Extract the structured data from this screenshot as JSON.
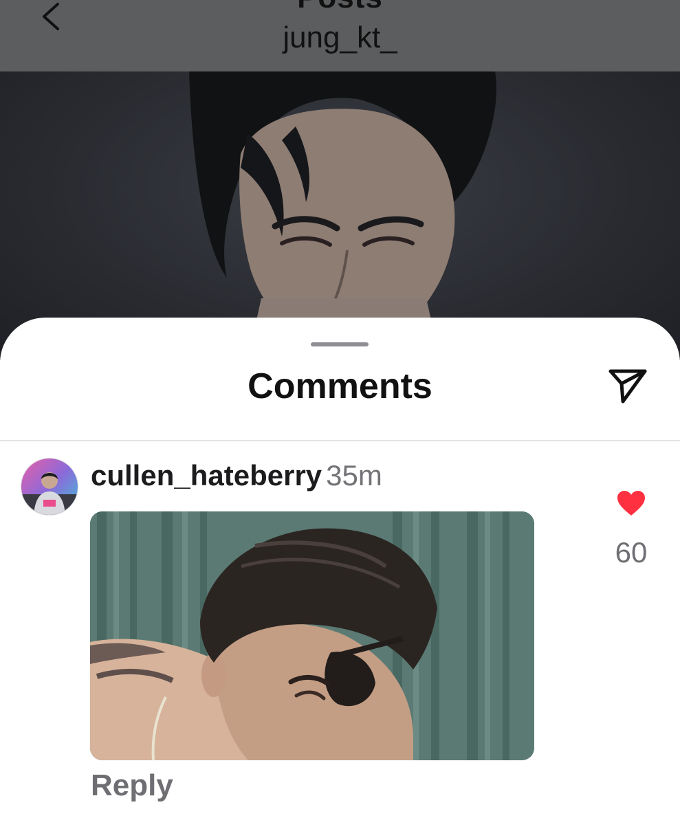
{
  "header": {
    "title": "Posts",
    "subtitle": "jung_kt_"
  },
  "sheet": {
    "title": "Comments"
  },
  "comment": {
    "username": "cullen_hateberry",
    "timestamp": "35m",
    "like_count": "60",
    "reply_label": "Reply"
  },
  "colors": {
    "like_heart": "#ff3040",
    "header_overlay": "#5c5d5f"
  },
  "icons": {
    "back": "chevron-left",
    "share": "paper-plane",
    "like": "heart-filled"
  }
}
